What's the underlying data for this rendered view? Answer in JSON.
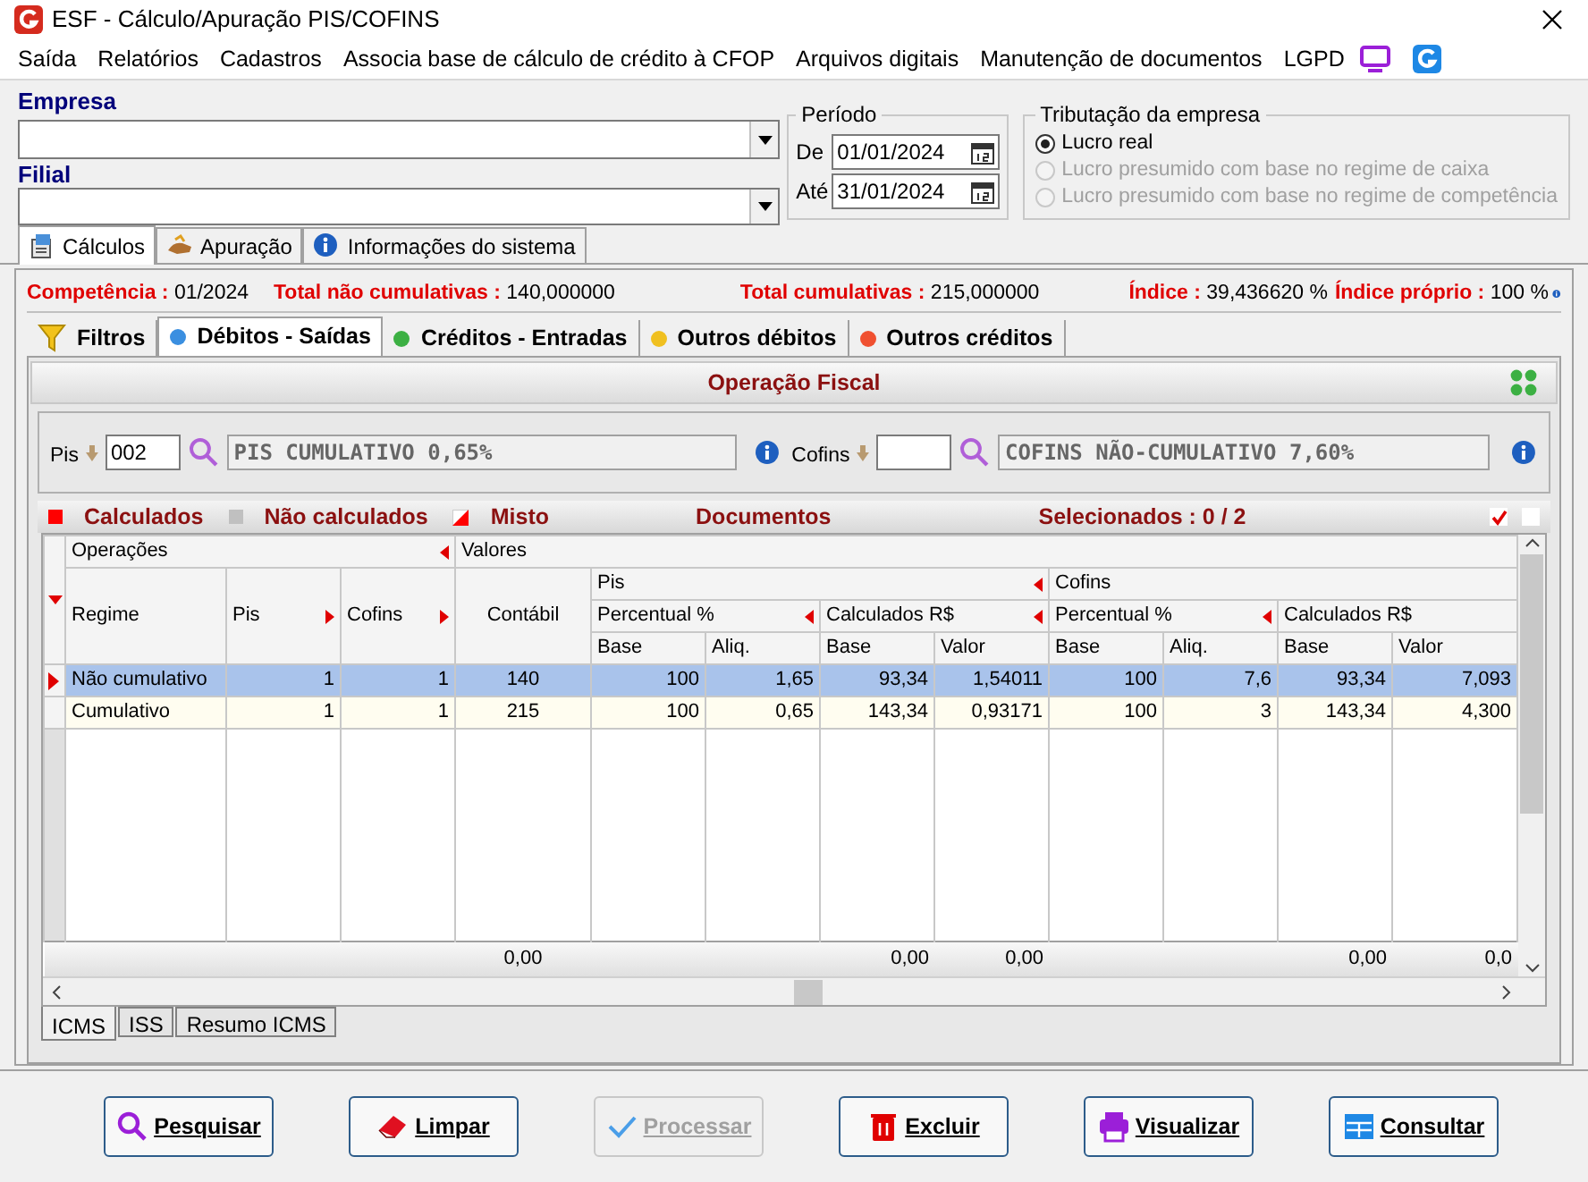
{
  "window": {
    "title": "ESF - Cálculo/Apuração PIS/COFINS"
  },
  "menu": [
    "Saída",
    "Relatórios",
    "Cadastros",
    "Associa base de cálculo de crédito à CFOP",
    "Arquivos digitais",
    "Manutenção de documentos",
    "LGPD"
  ],
  "empresa": {
    "label": "Empresa"
  },
  "filial": {
    "label": "Filial"
  },
  "periodo": {
    "title": "Período",
    "fields": [
      {
        "label": "De",
        "value": "01/01/2024"
      },
      {
        "label": "Até",
        "value": "31/01/2024"
      }
    ]
  },
  "tributacao": {
    "title": "Tributação da empresa",
    "options": [
      {
        "label": "Lucro real",
        "selected": true,
        "disabled": false
      },
      {
        "label": "Lucro presumido com base no regime de caixa",
        "selected": false,
        "disabled": true
      },
      {
        "label": "Lucro presumido com base no regime de competência",
        "selected": false,
        "disabled": true
      }
    ]
  },
  "top_tabs": [
    {
      "label": "Cálculos",
      "kind": "calc",
      "selected": true
    },
    {
      "label": "Apuração",
      "kind": "hand",
      "selected": false
    },
    {
      "label": "Informações do sistema",
      "kind": "info",
      "selected": false
    }
  ],
  "summary": [
    {
      "label": "Competência :",
      "value": "01/2024"
    },
    {
      "label": "Total não cumulativas :",
      "value": "140,000000"
    },
    {
      "label": "Total cumulativas :",
      "value": "215,000000"
    },
    {
      "label": "Índice :",
      "value": "39,436620 %"
    },
    {
      "label": "Índice próprio :",
      "value": "100 %"
    }
  ],
  "sub_tabs": [
    {
      "label": "Filtros",
      "kind": "filter",
      "selected": false
    },
    {
      "label": "Débitos - Saídas",
      "kind": "dot",
      "color": "#3b8fe0",
      "selected": true
    },
    {
      "label": "Créditos - Entradas",
      "kind": "dot",
      "color": "#3cb043",
      "selected": false
    },
    {
      "label": "Outros débitos",
      "kind": "dot",
      "color": "#f0c020",
      "selected": false
    },
    {
      "label": "Outros créditos",
      "kind": "dot",
      "color": "#f05030",
      "selected": false
    }
  ],
  "operacao": {
    "title": "Operação Fiscal",
    "pis": {
      "label": "Pis",
      "code": "002",
      "description": "PIS CUMULATIVO 0,65%"
    },
    "cofins": {
      "label": "Cofins",
      "description": "COFINS NÃO-CUMULATIVO 7,60%"
    }
  },
  "legend": [
    {
      "label": "Calculados",
      "kind": "solid",
      "color": "#ff0000"
    },
    {
      "label": "Não calculados",
      "kind": "solid",
      "color": "#c0c0c0"
    },
    {
      "label": "Misto",
      "kind": "split",
      "color": "#ff0000"
    }
  ],
  "documentos": "Documentos",
  "selecionados": "Selecionados : 0 / 2",
  "checks": [
    {
      "checked": true
    },
    {
      "checked": false
    }
  ],
  "grid": {
    "group_operacoes": "Operações",
    "group_valores": "Valores",
    "regime": "Regime",
    "pis": "Pis",
    "cofins": "Cofins",
    "contabil": "Contábil",
    "pis_group": "Pis",
    "cofins_group": "Cofins",
    "percentual": [
      "Percentual %",
      "Percentual %"
    ],
    "calculados": [
      "Calculados R$",
      "Calculados R$"
    ],
    "sub": [
      "Base",
      "Aliq.",
      "Base",
      "Valor",
      "Base",
      "Aliq.",
      "Base",
      "Valor"
    ],
    "rows": [
      {
        "selected": true,
        "cells": [
          "Não cumulativo",
          "1",
          "1",
          "140",
          "100",
          "1,65",
          "93,34",
          "1,54011",
          "100",
          "7,6",
          "93,34",
          "7,093"
        ]
      },
      {
        "selected": false,
        "cells": [
          "Cumulativo",
          "1",
          "1",
          "215",
          "100",
          "0,65",
          "143,34",
          "0,93171",
          "100",
          "3",
          "143,34",
          "4,300"
        ]
      }
    ],
    "totals": {
      "contabil": "0,00",
      "pis_calc_base": "0,00",
      "pis_valor": "0,00",
      "cofins_calc_base": "0,00",
      "cofins_valor": "0,0"
    }
  },
  "bottom_tabs": [
    {
      "label": "ICMS",
      "selected": true
    },
    {
      "label": "ISS",
      "selected": false
    },
    {
      "label": "Resumo ICMS",
      "selected": false
    }
  ],
  "buttons": [
    {
      "label": "Pesquisar",
      "kind": "search",
      "disabled": false
    },
    {
      "label": "Limpar",
      "kind": "eraser",
      "disabled": false
    },
    {
      "label": "Processar",
      "kind": "check",
      "disabled": true
    },
    {
      "label": "Excluir",
      "kind": "trash",
      "disabled": false
    },
    {
      "label": "Visualizar",
      "kind": "printer",
      "disabled": false
    },
    {
      "label": "Consultar",
      "kind": "table",
      "disabled": false
    }
  ]
}
